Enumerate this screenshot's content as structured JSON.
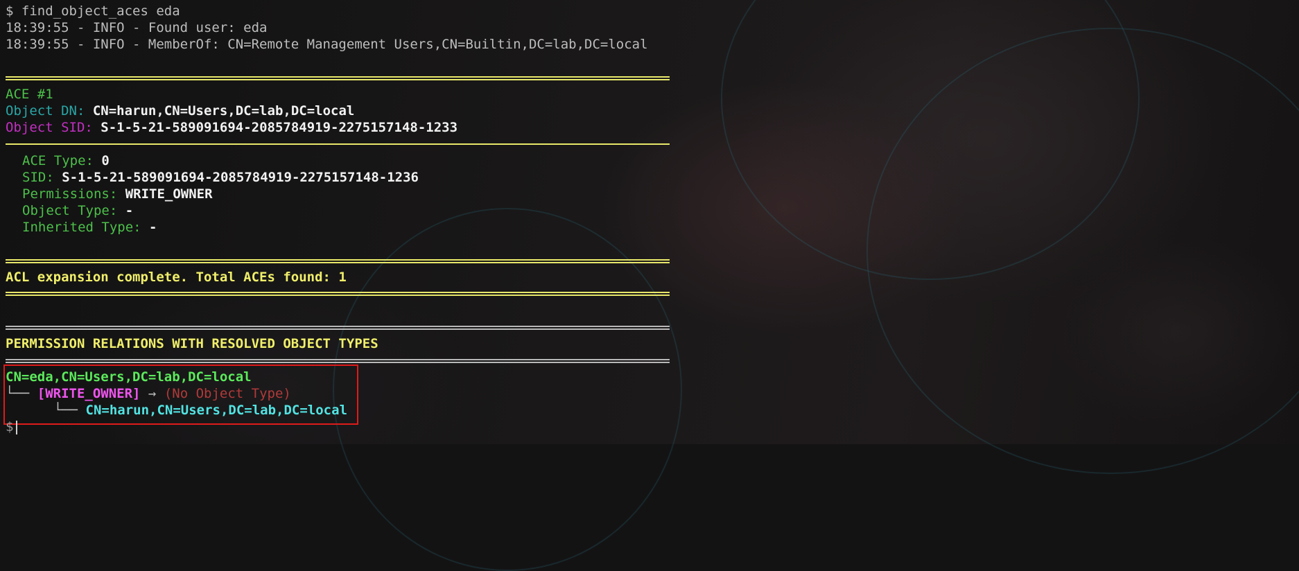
{
  "terminal": {
    "prompt_symbol": "$",
    "command": "find_object_aces eda",
    "log_lines": [
      "18:39:55 - INFO - Found user: eda",
      "18:39:55 - INFO - MemberOf: CN=Remote Management Users,CN=Builtin,DC=lab,DC=local"
    ],
    "ace": {
      "header_label": "ACE",
      "header_num": "#1",
      "object_dn_label": "Object DN:",
      "object_dn": "CN=harun,CN=Users,DC=lab,DC=local",
      "object_sid_label": "Object SID:",
      "object_sid": "S-1-5-21-589091694-2085784919-2275157148-1233",
      "ace_type_label": "ACE Type:",
      "ace_type": "0",
      "sid_label": "SID:",
      "sid": "S-1-5-21-589091694-2085784919-2275157148-1236",
      "permissions_label": "Permissions:",
      "permissions": "WRITE_OWNER",
      "object_type_label": "Object Type:",
      "object_type": "-",
      "inherited_type_label": "Inherited Type:",
      "inherited_type": "-"
    },
    "summary": "ACL expansion complete. Total ACEs found: 1",
    "relations_title": "PERMISSION RELATIONS WITH RESOLVED OBJECT TYPES",
    "tree": {
      "root": "CN=eda,CN=Users,DC=lab,DC=local",
      "branch_prefix": "└── ",
      "permission": "[WRITE_OWNER]",
      "arrow": " → ",
      "object_type": "(No Object Type)",
      "leaf_prefix": "    └── ",
      "target": "CN=harun,CN=Users,DC=lab,DC=local"
    },
    "final_prompt": "$"
  }
}
